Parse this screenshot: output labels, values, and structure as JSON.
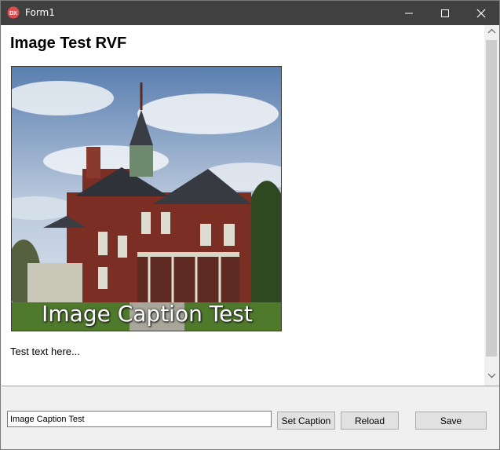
{
  "window": {
    "title": "Form1",
    "app_icon": "dx-logo-icon"
  },
  "document": {
    "heading": "Image Test RVF",
    "image_caption": "Image Caption Test",
    "body_text": "Test text here..."
  },
  "controls": {
    "caption_input_value": "Image Caption Test",
    "set_caption_label": "Set Caption",
    "reload_label": "Reload",
    "save_label": "Save"
  },
  "colors": {
    "titlebar": "#404040",
    "app_icon": "#e54b4b"
  }
}
